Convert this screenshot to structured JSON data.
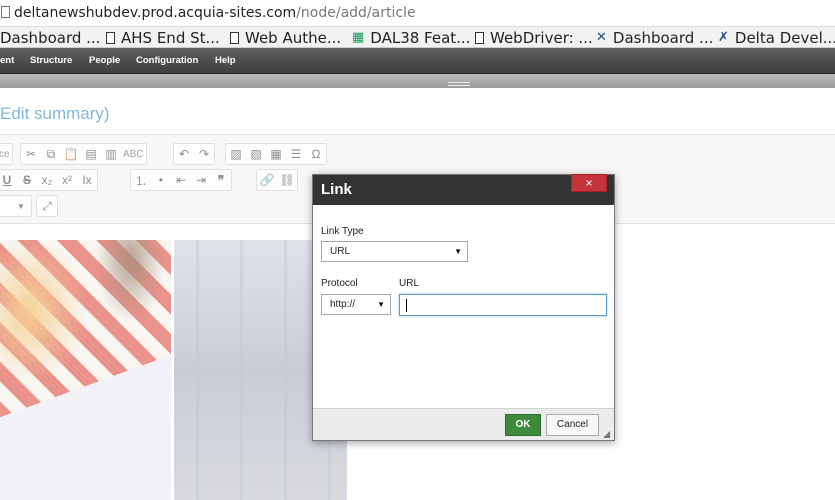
{
  "browser": {
    "url_host": "deltanewshubdev.prod.acquia-sites.com",
    "url_path": "/node/add/article"
  },
  "bookmarks": [
    {
      "label": "Dashboard ...",
      "icon": "document-icon"
    },
    {
      "label": "AHS End St...",
      "icon": "document-icon"
    },
    {
      "label": "Web Authe...",
      "icon": "document-icon"
    },
    {
      "label": "DAL38 Feat...",
      "icon": "spreadsheet-icon"
    },
    {
      "label": "WebDriver: ...",
      "icon": "document-icon"
    },
    {
      "label": "Dashboard ...",
      "icon": "jira-icon"
    },
    {
      "label": "Delta Devel...",
      "icon": "confluence-icon"
    }
  ],
  "admin_menu": {
    "content": "ent",
    "structure": "Structure",
    "people": "People",
    "configuration": "Configuration",
    "help": "Help"
  },
  "page": {
    "edit_summary": "Edit summary)"
  },
  "toolbar": {
    "source_label": "ce",
    "spellcheck_label": "ABC"
  },
  "dialog": {
    "title": "Link",
    "close_glyph": "×",
    "link_type_label": "Link Type",
    "link_type_value": "URL",
    "protocol_label": "Protocol",
    "protocol_value": "http://",
    "url_label": "URL",
    "url_value": "",
    "ok_label": "OK",
    "cancel_label": "Cancel"
  },
  "colors": {
    "ok_button": "#3d8a3c",
    "close_button": "#c6343b",
    "titlebar": "#333333",
    "link_accent": "#1f7bbf"
  }
}
